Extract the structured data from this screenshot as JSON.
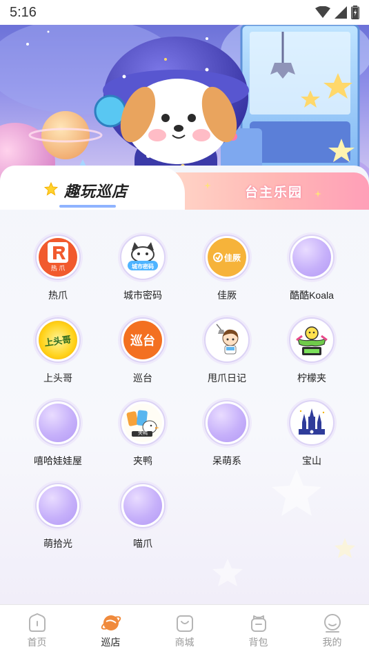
{
  "status_bar": {
    "time": "5:16"
  },
  "tabs": {
    "left_label": "趣玩巡店",
    "right_label": "台主乐园"
  },
  "stores": [
    {
      "name": "热爪",
      "logo_text": "热 爪",
      "logo_style": "red-r"
    },
    {
      "name": "城市密码",
      "logo_text": "城市密码",
      "logo_style": "cat"
    },
    {
      "name": "佳厥",
      "logo_text": "佳厥",
      "logo_style": "yellow"
    },
    {
      "name": "酷酷Koala",
      "logo_text": "",
      "logo_style": "placeholder"
    },
    {
      "name": "上头哥",
      "logo_text": "上头哥",
      "logo_style": "sun"
    },
    {
      "name": "巡台",
      "logo_text": "巡台",
      "logo_style": "orange"
    },
    {
      "name": "甩爪日记",
      "logo_text": "",
      "logo_style": "boy"
    },
    {
      "name": "柠檬夹",
      "logo_text": "",
      "logo_style": "lemon"
    },
    {
      "name": "嘻哈娃娃屋",
      "logo_text": "",
      "logo_style": "placeholder"
    },
    {
      "name": "夹鸭",
      "logo_text": "夹鸭",
      "logo_style": "duck"
    },
    {
      "name": "呆萌系",
      "logo_text": "",
      "logo_style": "placeholder"
    },
    {
      "name": "宝山",
      "logo_text": "",
      "logo_style": "castle"
    },
    {
      "name": "萌拾光",
      "logo_text": "",
      "logo_style": "placeholder"
    },
    {
      "name": "喵爪",
      "logo_text": "",
      "logo_style": "placeholder"
    }
  ],
  "nav": [
    {
      "label": "首页",
      "icon": "home-icon",
      "active": false
    },
    {
      "label": "巡店",
      "icon": "planet-icon",
      "active": true
    },
    {
      "label": "商城",
      "icon": "shop-bag-icon",
      "active": false
    },
    {
      "label": "背包",
      "icon": "backpack-icon",
      "active": false
    },
    {
      "label": "我的",
      "icon": "profile-icon",
      "active": false
    }
  ],
  "colors": {
    "accent": "#f08a3c",
    "tab_pink": "#ff9fb8",
    "placeholder_purple": "#c6b0fa"
  }
}
